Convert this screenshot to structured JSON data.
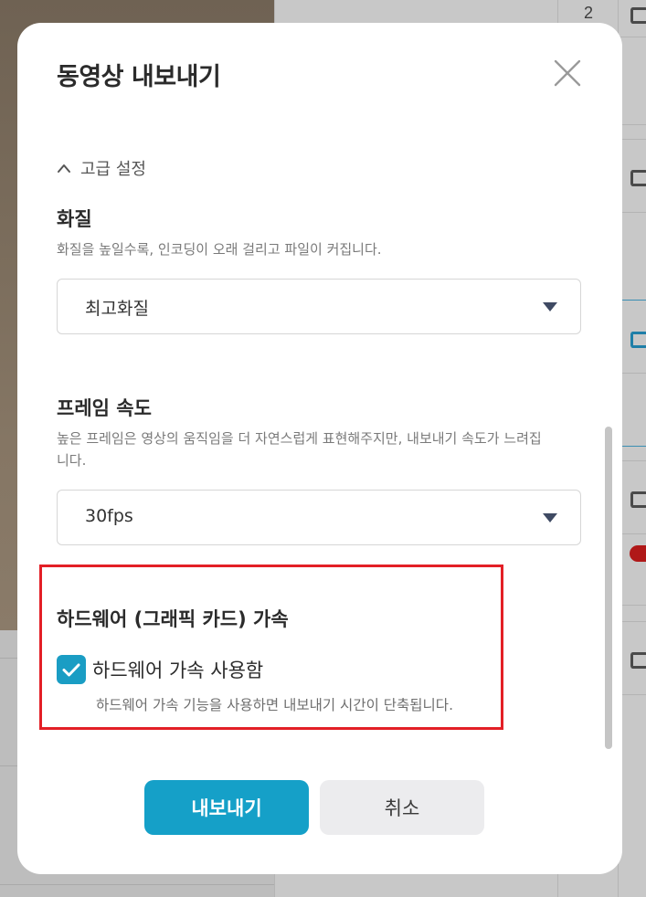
{
  "background": {
    "row_number": "2"
  },
  "dialog": {
    "title": "동영상 내보내기",
    "advanced_toggle_label": "고급 설정",
    "quality": {
      "label": "화질",
      "description": "화질을 높일수록, 인코딩이 오래 걸리고 파일이 커집니다.",
      "selected": "최고화질"
    },
    "frame_rate": {
      "label": "프레임 속도",
      "description": "높은 프레임은 영상의 움직임을 더 자연스럽게 표현해주지만, 내보내기 속도가 느려집니다.",
      "selected": "30fps"
    },
    "hardware": {
      "label": "하드웨어 (그래픽 카드) 가속",
      "checkbox_label": "하드웨어 가속 사용함",
      "checked": true,
      "description": "하드웨어 가속 기능을 사용하면 내보내기 시간이 단축됩니다."
    },
    "buttons": {
      "export": "내보내기",
      "cancel": "취소"
    }
  },
  "colors": {
    "accent": "#15a0c8",
    "highlight": "#e31f26",
    "secondary_button": "#ececee"
  },
  "icons": {
    "close": "close-icon",
    "toggle": "chevron-up-icon",
    "dropdown": "caret-down-icon",
    "check": "check-icon"
  }
}
